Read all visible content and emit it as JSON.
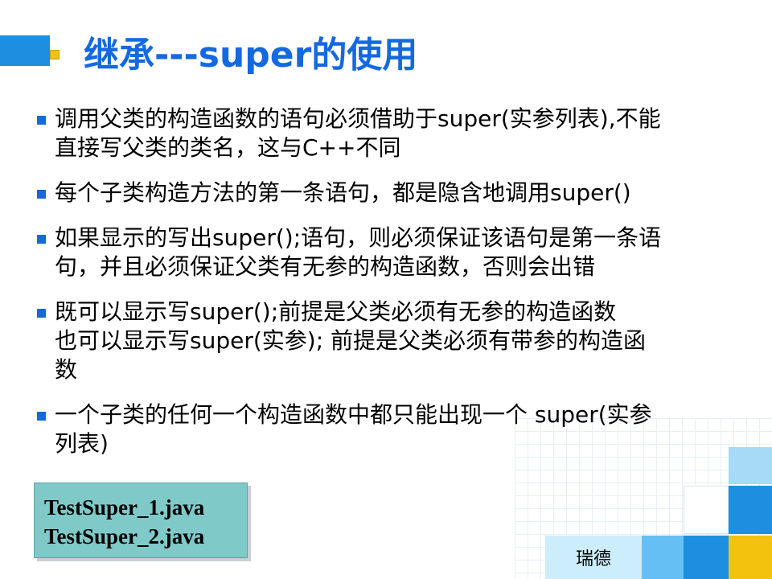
{
  "slide": {
    "title": "继承---super的使用",
    "bullets": [
      {
        "lines": [
          "调用父类的构造函数的语句必须借助于super(实参列表),不能",
          "直接写父类的类名，这与C++不同"
        ]
      },
      {
        "lines": [
          "每个子类构造方法的第一条语句，都是隐含地调用super()"
        ]
      },
      {
        "lines": [
          "如果显示的写出super();语句，则必须保证该语句是第一条语",
          "句，并且必须保证父类有无参的构造函数，否则会出错"
        ]
      },
      {
        "lines": [
          "既可以显示写super();前提是父类必须有无参的构造函数",
          "也可以显示写super(实参); 前提是父类必须有带参的构造函",
          "数"
        ]
      },
      {
        "lines": [
          "一个子类的任何一个构造函数中都只能出现一个 super(实参",
          "列表)"
        ]
      }
    ],
    "code_files": [
      "TestSuper_1.java",
      "TestSuper_2.java"
    ],
    "footer": "瑞德"
  },
  "colors": {
    "title": "#1469e0",
    "bullet_marker": "#1669d6",
    "header_bar": "#1e8fe0",
    "header_square": "#f2c20f",
    "code_box": "#80c9c9",
    "footer_bg": "#cceefc"
  },
  "icons": [
    "bullet-square-icon",
    "header-square-icon"
  ]
}
